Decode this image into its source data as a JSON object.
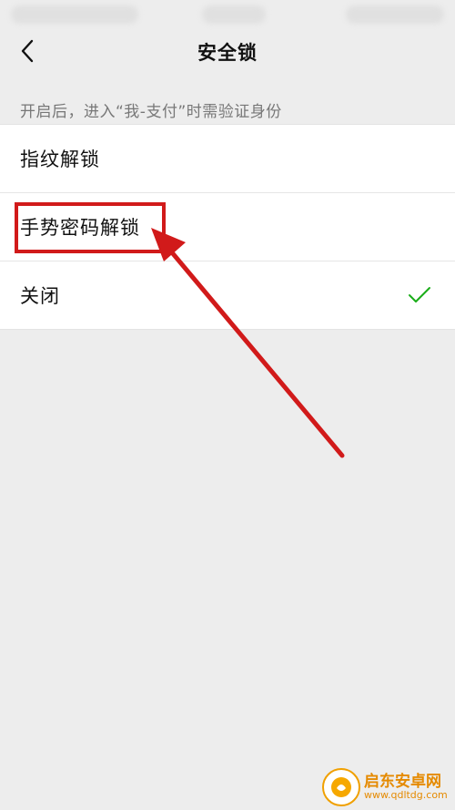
{
  "nav": {
    "title": "安全锁",
    "back_icon": "chevron-left-icon"
  },
  "hint": "开启后，进入“我-支付”时需验证身份",
  "options": [
    {
      "label": "指纹解锁",
      "selected": false
    },
    {
      "label": "手势密码解锁",
      "selected": false
    },
    {
      "label": "关闭",
      "selected": true
    }
  ],
  "annotation": {
    "color": "#d11a1a"
  },
  "watermark": {
    "name": "启东安卓网",
    "url": "www.qdltdg.com"
  },
  "colors": {
    "background": "#ededed",
    "check": "#1aad19"
  }
}
